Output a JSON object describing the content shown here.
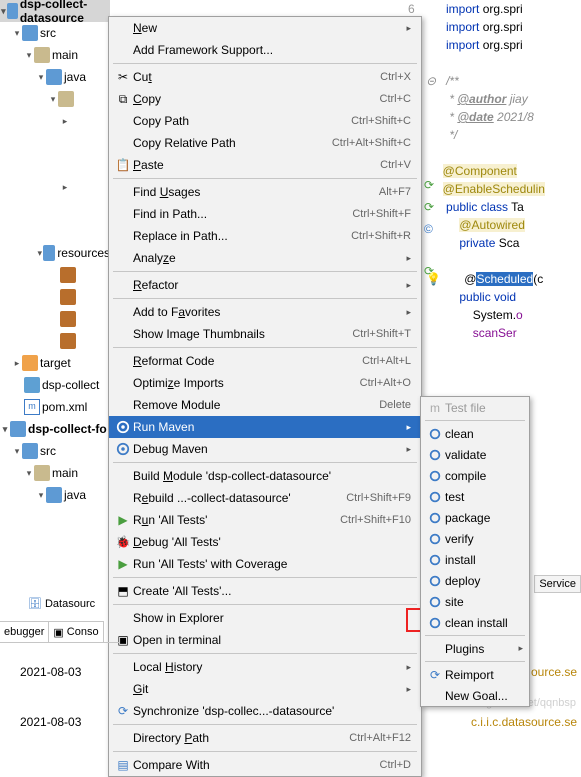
{
  "tree": {
    "root": "dsp-collect-datasource",
    "src": "src",
    "main": "main",
    "java": "java",
    "resources": "resources",
    "target": "target",
    "iml": "dsp-collect",
    "pom": "pom.xml",
    "fo": "dsp-collect-fo",
    "src2": "src",
    "main2": "main",
    "java2": "java"
  },
  "menu": {
    "new": "New",
    "addfw": "Add Framework Support...",
    "cut": "Cut",
    "cut_sc": "Ctrl+X",
    "copy": "Copy",
    "copy_sc": "Ctrl+C",
    "copy_path": "Copy Path",
    "copy_path_sc": "Ctrl+Shift+C",
    "copy_rel": "Copy Relative Path",
    "copy_rel_sc": "Ctrl+Alt+Shift+C",
    "paste": "Paste",
    "paste_sc": "Ctrl+V",
    "find_usages": "Find Usages",
    "find_usages_sc": "Alt+F7",
    "find_in_path": "Find in Path...",
    "find_in_path_sc": "Ctrl+Shift+F",
    "replace_in_path": "Replace in Path...",
    "replace_in_path_sc": "Ctrl+Shift+R",
    "analyze": "Analyze",
    "refactor": "Refactor",
    "add_fav": "Add to Favorites",
    "show_thumb": "Show Image Thumbnails",
    "show_thumb_sc": "Ctrl+Shift+T",
    "reformat": "Reformat Code",
    "reformat_sc": "Ctrl+Alt+L",
    "opt_imp": "Optimize Imports",
    "opt_imp_sc": "Ctrl+Alt+O",
    "rem_mod": "Remove Module",
    "rem_mod_sc": "Delete",
    "run_maven": "Run Maven",
    "debug_maven": "Debug Maven",
    "build_mod": "Build Module 'dsp-collect-datasource'",
    "rebuild": "Rebuild ...-collect-datasource'",
    "rebuild_sc": "Ctrl+Shift+F9",
    "run_all": "Run 'All Tests'",
    "run_all_sc": "Ctrl+Shift+F10",
    "debug_all": "Debug 'All Tests'",
    "cov_all": "Run 'All Tests' with Coverage",
    "create_all": "Create 'All Tests'...",
    "show_expl": "Show in Explorer",
    "open_term": "Open in terminal",
    "local_hist": "Local History",
    "git": "Git",
    "sync": "Synchronize 'dsp-collec...-datasource'",
    "dir_path": "Directory Path",
    "dir_path_sc": "Ctrl+Alt+F12",
    "compare": "Compare With",
    "compare_sc": "Ctrl+D"
  },
  "sub": {
    "testfile": "Test file",
    "clean": "clean",
    "validate": "validate",
    "compile": "compile",
    "test": "test",
    "package": "package",
    "verify": "verify",
    "install": "install",
    "deploy": "deploy",
    "site": "site",
    "clean_install": "clean install",
    "plugins": "Plugins",
    "reimport": "Reimport",
    "new_goal": "New Goal..."
  },
  "code": {
    "line6": "6",
    "import": "import",
    "pkg": " org.spri",
    "docstart": "/**",
    "author": "@author",
    "author_val": " jiay",
    "date": "@date",
    "date_val": " 2021/8",
    "docend": " */",
    "component": "@Component",
    "enablesched": "@EnableSchedulin",
    "public": "public",
    "class": "class",
    "cname": " Ta",
    "autowired": "@Autowired",
    "private": "private",
    "ptype": " Sca",
    "scheduled": "Scheduled",
    "scheduled_args": "(c",
    "void": "void",
    "system": "System.",
    "system_end": "o",
    "scanser": "scanSer"
  },
  "tabs": {
    "debugger": "ebugger",
    "datasource": "Datasourc",
    "conso": "Conso"
  },
  "console": {
    "t1": "2021-08-03",
    "t2": "2021-08-03",
    "line1": "c.i.i.c.datasource.se",
    "line2": "ource.se"
  },
  "svc": "Service",
  "watermark": "og.csdn.net/qqnbsp"
}
